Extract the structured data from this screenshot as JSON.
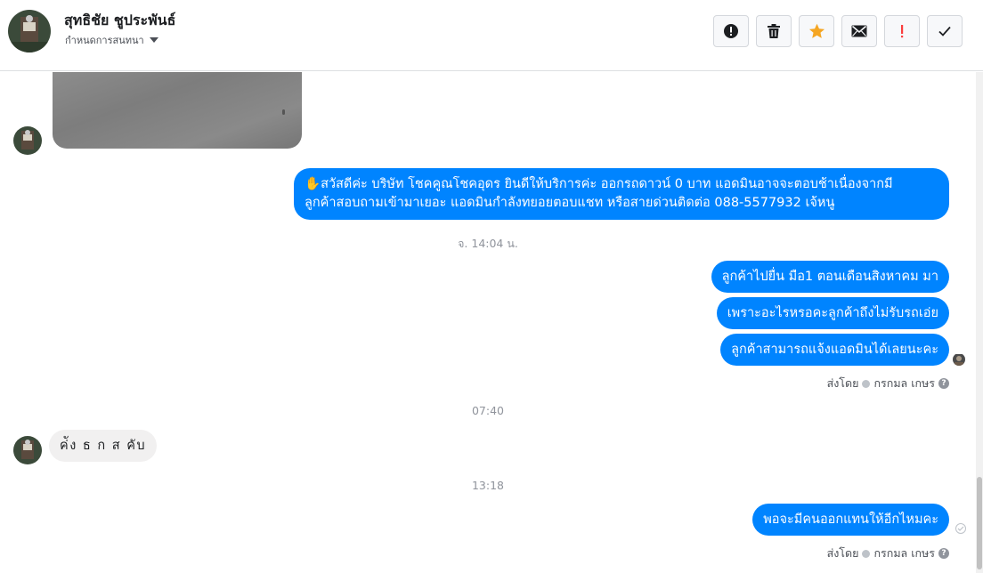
{
  "header": {
    "contact_name": "สุทธิชัย ชูประพันธ์",
    "assign_label": "กำหนดการสนทนา"
  },
  "toolbar": {
    "buttons": [
      {
        "icon": "alert-circle-icon",
        "color": "#1c1e21"
      },
      {
        "icon": "trash-icon",
        "color": "#1c1e21"
      },
      {
        "icon": "star-icon",
        "color": "#f5a623"
      },
      {
        "icon": "envelope-icon",
        "color": "#1c1e21"
      },
      {
        "icon": "exclamation-icon",
        "color": "#fa3e3e"
      },
      {
        "icon": "checkmark-icon",
        "color": "#1c1e21"
      }
    ]
  },
  "colors": {
    "outgoing_bubble": "#0084ff",
    "incoming_bubble": "#f1f0f0"
  },
  "messages": {
    "greeting": {
      "emoji": "✋",
      "line1": "สวัสดีค่ะ บริษัท โชคคูณโชคอุดร ยินดีให้บริการค่ะ ออกรถดาวน์ 0 บาท แอดมินอาจจะตอบช้าเนื่องจากมี",
      "line2": "ลูกค้าสอบถามเข้ามาเยอะ แอดมินกำลังทยอยตอบแชท หรือสายด่วนติดต่อ 088-5577932 เจ้หนู"
    },
    "time1": "จ. 14:04 น.",
    "out1": "ลูกค้าไปยื่น มือ1 ตอนเดือนสิงหาคม มา",
    "out2": "เพราะอะไรหรอคะลูกค้าถึงไม่รับรถเอ่ย",
    "out3": "ลูกค้าสามารถแจ้งแอดมินได้เลยนะคะ",
    "sent_by_1": "ส่งโดย",
    "sender_1": "กรกมล เกษร",
    "time2": "07:40",
    "in1": "ค่ัง ธ ก ส คับ",
    "time3": "13:18",
    "out4": "พอจะมีคนออกแทนให้อีกไหมคะ",
    "sent_by_2": "ส่งโดย",
    "sender_2": "กรกมล เกษร"
  }
}
